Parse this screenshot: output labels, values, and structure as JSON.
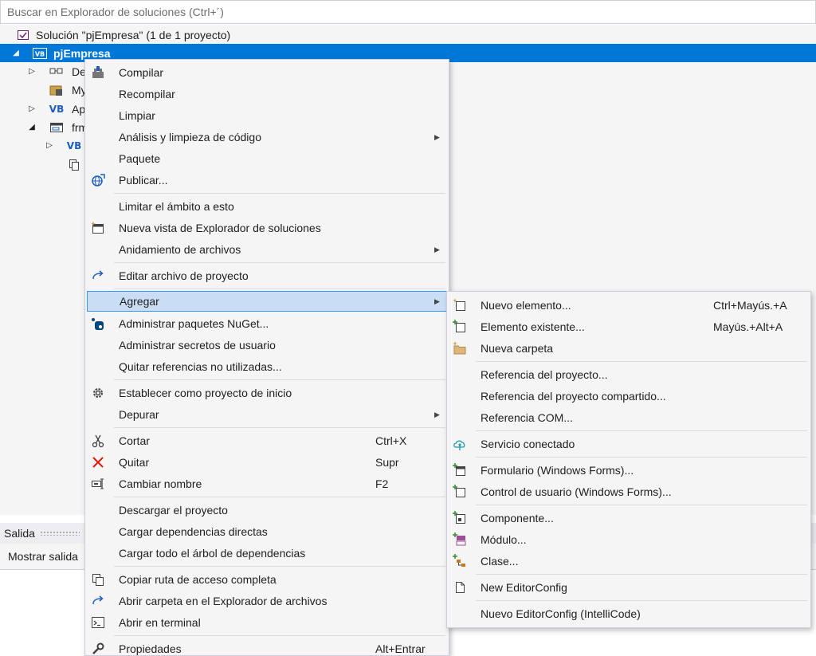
{
  "search": {
    "placeholder": "Buscar en Explorador de soluciones (Ctrl+´)"
  },
  "tree": {
    "solution": "Solución \"pjEmpresa\"  (1 de 1 proyecto)",
    "project": "pjEmpresa",
    "items": [
      {
        "label": "De",
        "icon": "dependencies-icon"
      },
      {
        "label": "My",
        "icon": "my-project-icon"
      },
      {
        "label": "Ap",
        "icon": "vb-file-icon"
      },
      {
        "label": "frm",
        "icon": "form-icon"
      },
      {
        "label": "VB",
        "icon": "vb-file-icon"
      },
      {
        "label": "",
        "icon": "resource-file-icon"
      }
    ]
  },
  "output": {
    "title": "Salida",
    "show_label": "Mostrar salida"
  },
  "context_menu": {
    "items": [
      {
        "label": "Compilar"
      },
      {
        "label": "Recompilar"
      },
      {
        "label": "Limpiar"
      },
      {
        "label": "Análisis y limpieza de código"
      },
      {
        "label": "Paquete"
      },
      {
        "label": "Publicar..."
      },
      {
        "label": "Limitar el ámbito a esto"
      },
      {
        "label": "Nueva vista de Explorador de soluciones"
      },
      {
        "label": "Anidamiento de archivos"
      },
      {
        "label": "Editar archivo de proyecto"
      },
      {
        "label": "Agregar"
      },
      {
        "label": "Administrar paquetes NuGet..."
      },
      {
        "label": "Administrar secretos de usuario"
      },
      {
        "label": "Quitar referencias no utilizadas..."
      },
      {
        "label": "Establecer como proyecto de inicio"
      },
      {
        "label": "Depurar"
      },
      {
        "label": "Cortar",
        "shortcut": "Ctrl+X"
      },
      {
        "label": "Quitar",
        "shortcut": "Supr"
      },
      {
        "label": "Cambiar nombre",
        "shortcut": "F2"
      },
      {
        "label": "Descargar el proyecto"
      },
      {
        "label": "Cargar dependencias directas"
      },
      {
        "label": "Cargar todo el árbol de dependencias"
      },
      {
        "label": "Copiar ruta de acceso completa"
      },
      {
        "label": "Abrir carpeta en el Explorador de archivos"
      },
      {
        "label": "Abrir en terminal"
      },
      {
        "label": "Propiedades",
        "shortcut": "Alt+Entrar"
      }
    ]
  },
  "submenu": {
    "items": [
      {
        "label": "Nuevo elemento...",
        "shortcut": "Ctrl+Mayús.+A"
      },
      {
        "label": "Elemento existente...",
        "shortcut": "Mayús.+Alt+A"
      },
      {
        "label": "Nueva carpeta"
      },
      {
        "label": "Referencia del proyecto..."
      },
      {
        "label": "Referencia del proyecto compartido..."
      },
      {
        "label": "Referencia COM..."
      },
      {
        "label": "Servicio conectado"
      },
      {
        "label": "Formulario (Windows Forms)..."
      },
      {
        "label": "Control de usuario (Windows Forms)..."
      },
      {
        "label": "Componente..."
      },
      {
        "label": "Módulo..."
      },
      {
        "label": "Clase..."
      },
      {
        "label": "New EditorConfig"
      },
      {
        "label": "Nuevo EditorConfig (IntelliCode)"
      }
    ]
  },
  "colors": {
    "selection": "#0078d7",
    "hover": "#c9def5",
    "hover_border": "#3399ff"
  }
}
